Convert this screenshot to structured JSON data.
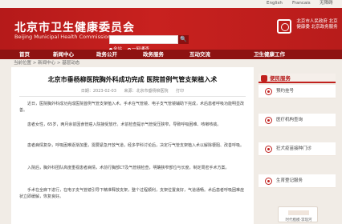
{
  "lang": [
    "English",
    "Francais",
    "无障碍"
  ],
  "header": {
    "title": "北京市卫生健康委员会",
    "subtitle": "Beijing Municipal Health Commission",
    "search_button": "🔍",
    "radio": [
      "全站",
      "一网通查"
    ],
    "logo_text": "北京市人民政府 北京健康委 北京政务服务"
  },
  "nav": [
    "首页",
    "新闻中心",
    "政务公开",
    "政务服务",
    "互动交流",
    "卫生健康工作"
  ],
  "breadcrumb": "当前位置 > 新闻中心 > 基层动态",
  "article": {
    "title": "北京市垂杨柳医院胸外科成功完成 医院首例气管支架植入术",
    "date": "日期：2023-02-03",
    "source": "来源：北京市垂杨柳医院",
    "print": "打印",
    "paragraphs": [
      "近日，医院胸外科成功完成医院首例气管支架植入术。手术在气管镜、电子支气管镜辅助下完成，术后患者呼吸功能明显改善。",
      "患者女性，65岁，两月余前因食管癌入院接受放疗。术前检查提示气管受压狭窄，导致呼吸困难、咳嗽咳痰。",
      "患者病情复杂，呼吸困难逐渐加重，需要紧急开放气道，经多学科讨论后，决定行气管支架植入术以解除梗阻、改善呼吸。",
      "入院后，胸外科团队高度重视患者病情，术前行胸部CT及气管镜检查，明确狭窄部位与长度，制定周密手术方案。",
      "手术在全麻下进行，在电子支气管镜引导下精准释放支架，整个过程顺利，支架位置良好，气道通畅。术后患者呼吸困难症状立即缓解，恢复良好。"
    ]
  },
  "sidebar": {
    "panel_title": "便民服务",
    "services": [
      "预约挂号",
      "医疗机构查询",
      "狂犬疫苗接种门诊",
      "生育登记服务"
    ],
    "card": "时代楷模·李现河"
  },
  "colors": {
    "brand_red": "#c0201d",
    "nav_dark": "#8e1312",
    "bg": "#f1ece6"
  }
}
